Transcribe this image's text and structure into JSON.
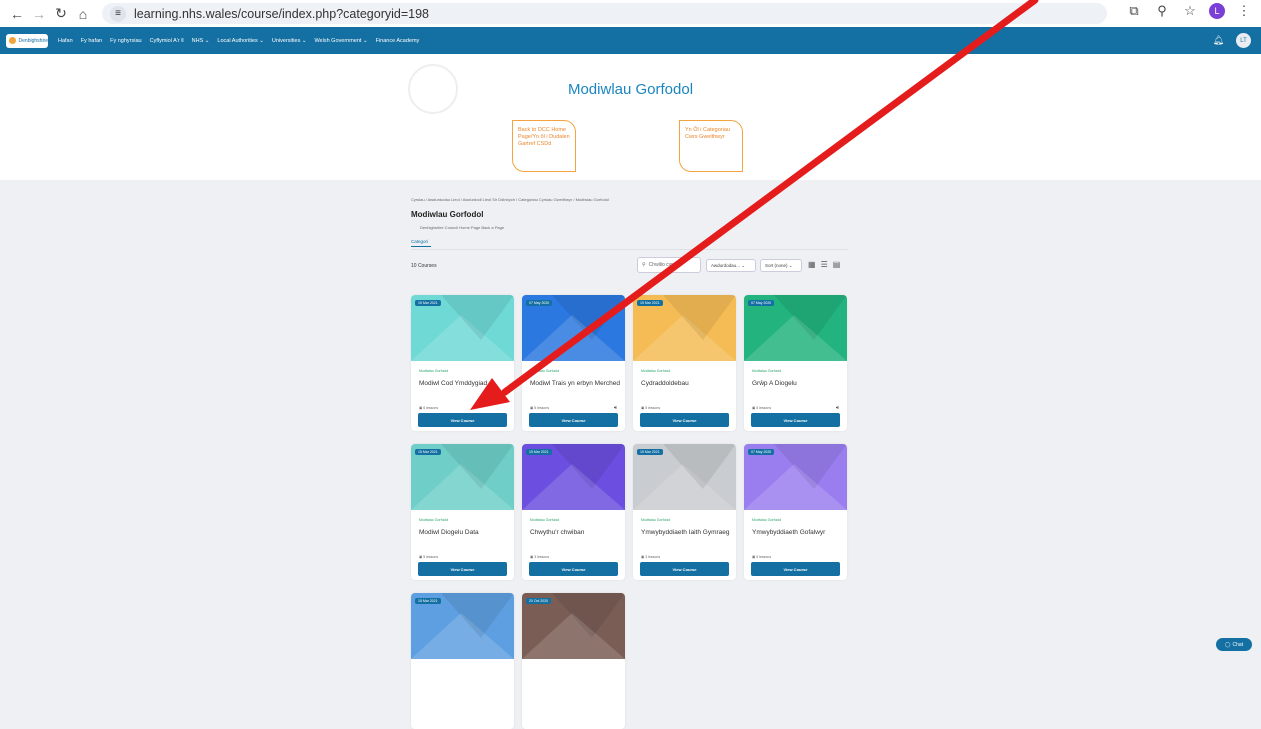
{
  "browser": {
    "url": "learning.nhs.wales/course/index.php?categoryid=198",
    "profile_initial": "L"
  },
  "site_nav": {
    "logo_text": "Denbighshire",
    "links": [
      "Hafan",
      "Fy hafan",
      "Fy nghyrsiau",
      "Cyflymiol A'r ll",
      "NHS ⌄",
      "Local Authorities ⌄",
      "Universities ⌄",
      "Welsh Government ⌄",
      "Finance Academy"
    ],
    "avatar_initials": "LT"
  },
  "hero": {
    "title": "Modiwlau Gorfodol",
    "btn1": "Back to DCC Home Page/Yn ôl i Dudalen Gartref CSDd",
    "btn2": "Yn Ôl i Categoriau Cwrs Gweithwyr"
  },
  "content": {
    "breadcrumb": "Cyrsiau / Awdurdodau Lleol / Awdurdodi Lleol Sir Ddinbych / Categoriau Cyrsiau Gweithwyr / Modiwlau Gorfodol",
    "category_title": "Modiwlau Gorfodol",
    "category_subtitle": "Denbighshire Council Home Page Back a Page",
    "tab_active": "Categori",
    "course_count": "10 Courses",
    "search_placeholder": "Chwilio cyrsiau",
    "filter_select": "Awdurdodau...  ⌄",
    "sort_select": "Sort (none)  ⌄"
  },
  "cards": [
    {
      "date": "15 Mar 2021",
      "category": "Modiwlau Gorfodol",
      "title": "Modiwl Cod Ymddygiad",
      "lessons": "6 lessons",
      "audio": false,
      "button": "View Course",
      "color": "#6fd9d6"
    },
    {
      "date": "07 May 2020",
      "category": "Modiwlau Gorfodol",
      "title": "Modiwl Trais yn erbyn Merched",
      "lessons": "5 lessons",
      "audio": true,
      "button": "View Course",
      "color": "#2b78e0"
    },
    {
      "date": "15 Mar 2021",
      "category": "Modiwlau Gorfodol",
      "title": "Cydraddoldebau",
      "lessons": "5 lessons",
      "audio": false,
      "button": "View Course",
      "color": "#f5bc55"
    },
    {
      "date": "07 May 2020",
      "category": "Modiwlau Gorfodol",
      "title": "Grŵp A Diogelu",
      "lessons": "5 lessons",
      "audio": true,
      "button": "View Course",
      "color": "#22b37e"
    },
    {
      "date": "15 Mar 2021",
      "category": "Modiwlau Gorfodol",
      "title": "Modiwl Diogelu Data",
      "lessons": "5 lessons",
      "audio": false,
      "button": "View Course",
      "color": "#6fcfc8"
    },
    {
      "date": "15 Mar 2021",
      "category": "Modiwlau Gorfodol",
      "title": "Chwythu'r chwiban",
      "lessons": "3 lessons",
      "audio": false,
      "button": "View Course",
      "color": "#6c4fe0"
    },
    {
      "date": "15 Mar 2021",
      "category": "Modiwlau Gorfodol",
      "title": "Ymwybyddiaeth Iaith Gymraeg",
      "lessons": "3 lessons",
      "audio": false,
      "button": "View Course",
      "color": "#c9ccd0"
    },
    {
      "date": "07 May 2020",
      "category": "Modiwlau Gorfodol",
      "title": "Ymwybyddiaeth Gofalwyr",
      "lessons": "5 lessons",
      "audio": false,
      "button": "View Course",
      "color": "#9a7ef0"
    },
    {
      "date": "15 Mar 2021",
      "category": "",
      "title": "",
      "lessons": "",
      "audio": false,
      "button": "",
      "color": "#5d9fe0"
    },
    {
      "date": "20 Oct 2020",
      "category": "",
      "title": "",
      "lessons": "",
      "audio": false,
      "button": "",
      "color": "#7a5d55"
    }
  ],
  "chat_label": "Chat",
  "colors": {
    "nav": "#1470a2",
    "accent": "#f3a441",
    "annotation_arrow": "#e51c1c"
  }
}
